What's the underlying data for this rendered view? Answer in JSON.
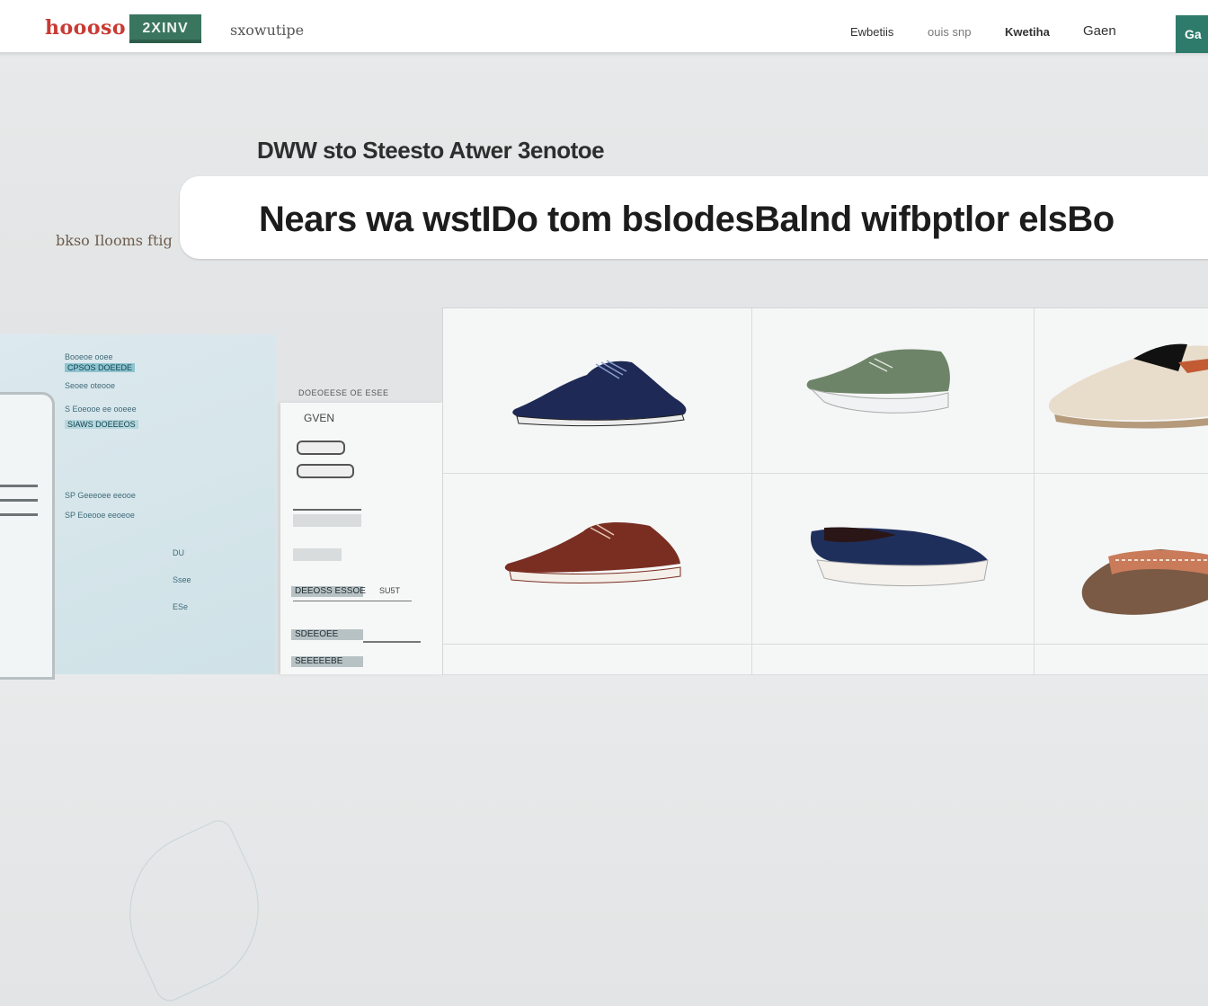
{
  "nav": {
    "logo": "hoooso",
    "badge": "2XINV",
    "brand_sub": "sxowutipe",
    "links": [
      "Ewbetiis",
      "ouis snp",
      "Kwetiha",
      "Gaen"
    ],
    "cta": "Ga"
  },
  "hero": {
    "subtitle": "DWW sto Steesto Atwer 3enotoe",
    "title": "Nears  wa wstIDo tom bslodesBalnd  wifbptlor elsBo",
    "side_note": "bkso Ilooms ftig"
  },
  "left_card": {
    "lines": [
      "Booeoe ooee",
      "CPSOS DOEEDE",
      "Seoee oteooe",
      "S Eoeooe ee ooeee",
      "SIAWS DOEEEOS",
      "SP Geeeoee eeooe",
      "SP Eoeooe eeoeoe",
      "DU",
      "Ssee",
      "ESe"
    ]
  },
  "mid_card": {
    "header": "DOEOEESE OE ESEE",
    "item1": "GVEN",
    "bar1": "DEEOSS ESSOE",
    "bar1_value": "SU5T",
    "bar2": "SDEEOEE",
    "bar3": "SEEEEEBE"
  },
  "products": [
    {
      "name": "navy-brogue-shoe",
      "color": "#1e2a55"
    },
    {
      "name": "sage-slip-on-shoe",
      "color": "#6e8468"
    },
    {
      "name": "cream-sneaker",
      "color": "#e8dccb"
    },
    {
      "name": "brown-oxford-shoe",
      "color": "#7a2e22"
    },
    {
      "name": "navy-loafer",
      "color": "#1f2f5c"
    },
    {
      "name": "pattern-slip-on",
      "color": "#c97b5a"
    }
  ]
}
